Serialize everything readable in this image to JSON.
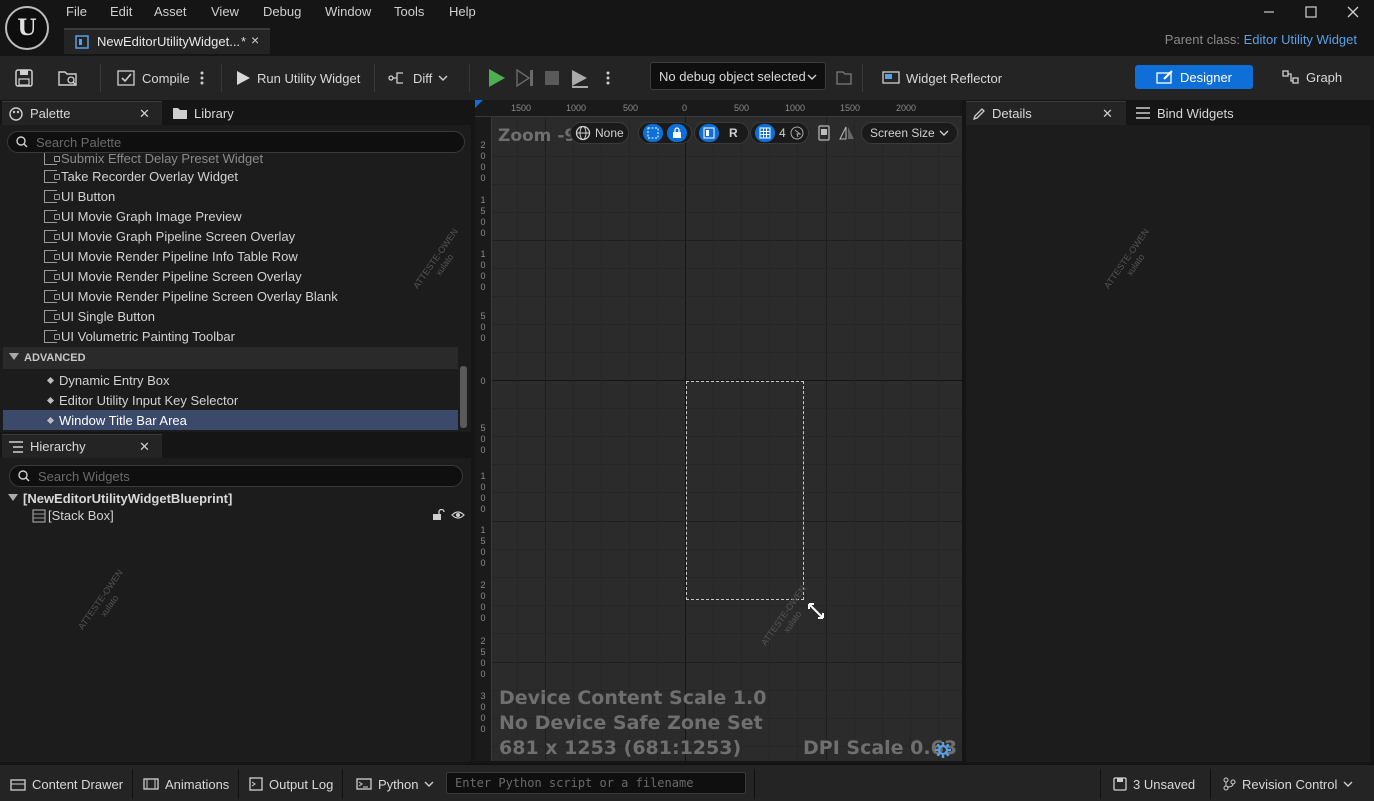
{
  "app": {
    "menu": [
      "File",
      "Edit",
      "Asset",
      "View",
      "Debug",
      "Window",
      "Tools",
      "Help"
    ],
    "document_tab": {
      "label": "NewEditorUtilityWidget...",
      "modified_marker": "*",
      "close": "×"
    },
    "parent_class": {
      "label": "Parent class:",
      "value": "Editor Utility Widget"
    }
  },
  "toolbar": {
    "compile_label": "Compile",
    "run_label": "Run Utility Widget",
    "diff_label": "Diff",
    "debug_object": "No debug object selected",
    "widget_reflector_label": "Widget Reflector",
    "designer_label": "Designer",
    "graph_label": "Graph"
  },
  "palette": {
    "tab_label": "Palette",
    "library_label": "Library",
    "search_placeholder": "Search Palette",
    "partial_item": "Submix Effect Delay Preset Widget",
    "items": [
      "Take Recorder Overlay Widget",
      "UI Button",
      "UI Movie Graph Image Preview",
      "UI Movie Graph Pipeline Screen Overlay",
      "UI Movie Render Pipeline Info Table Row",
      "UI Movie Render Pipeline Screen Overlay",
      "UI Movie Render Pipeline Screen Overlay Blank",
      "UI Single Button",
      "UI Volumetric Painting Toolbar"
    ],
    "advanced_header": "ADVANCED",
    "advanced_items": [
      "Dynamic Entry Box",
      "Editor Utility Input Key Selector",
      "Window Title Bar Area"
    ],
    "selected_advanced": "Window Title Bar Area"
  },
  "hierarchy": {
    "tab_label": "Hierarchy",
    "search_placeholder": "Search Widgets",
    "root": "[NewEditorUtilityWidgetBlueprint]",
    "child": "[Stack Box]"
  },
  "viewport": {
    "zoom_text": "Zoom -9",
    "none_label": "None",
    "r_label": "R",
    "grid_value": "4",
    "screen_size_label": "Screen Size",
    "ruler_top": [
      "1500",
      "1000",
      "500",
      "0",
      "500",
      "1000",
      "1500",
      "2000"
    ],
    "ruler_left": [
      "2000",
      "1500",
      "1000",
      "500",
      "0",
      "500",
      "1000",
      "1500",
      "2000",
      "2500",
      "3000"
    ],
    "device_scale": "Device Content Scale 1.0",
    "safe_zone": "No Device Safe Zone Set",
    "resolution": "681 x 1253 (681:1253)",
    "dpi_scale": "DPI Scale 0.63"
  },
  "details": {
    "tab_label": "Details",
    "bind_widgets_label": "Bind Widgets"
  },
  "bottombar": {
    "content_drawer": "Content Drawer",
    "animations": "Animations",
    "output_log": "Output Log",
    "python_label": "Python",
    "python_placeholder": "Enter Python script or a filename",
    "unsaved": "3 Unsaved",
    "revision_control": "Revision Control"
  },
  "colors": {
    "accent": "#0e6fd8",
    "link": "#5aa0e6",
    "play_green": "#4caf50",
    "selection": "#3b4a6b"
  }
}
